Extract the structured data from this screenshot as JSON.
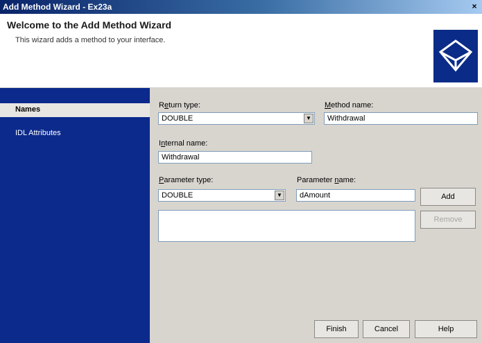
{
  "window": {
    "title": "Add Method Wizard - Ex23a",
    "close_glyph": "×"
  },
  "header": {
    "title": "Welcome to the Add Method Wizard",
    "subtitle": "This wizard adds a method to your interface.",
    "logo_icon": "cube-wireframe-icon"
  },
  "sidebar": {
    "items": [
      {
        "label": "Names",
        "selected": true
      },
      {
        "label": "IDL Attributes",
        "selected": false
      }
    ]
  },
  "form": {
    "return_type": {
      "label_pre": "R",
      "label_mnemonic": "e",
      "label_post": "turn type:",
      "value": "DOUBLE"
    },
    "method_name": {
      "label_pre": "",
      "label_mnemonic": "M",
      "label_post": "ethod name:",
      "value": "Withdrawal"
    },
    "internal_name": {
      "label_pre": "I",
      "label_mnemonic": "n",
      "label_post": "ternal name:",
      "value": "Withdrawal"
    },
    "parameter_type": {
      "label_pre": "",
      "label_mnemonic": "P",
      "label_post": "arameter type:",
      "value": "DOUBLE"
    },
    "parameter_name": {
      "label_pre": "Parameter ",
      "label_mnemonic": "n",
      "label_post": "ame:",
      "value": "dAmount"
    },
    "dropdown_glyph": "▼"
  },
  "buttons": {
    "add": "Add",
    "remove": "Remove",
    "finish": "Finish",
    "cancel": "Cancel",
    "help": "Help"
  }
}
